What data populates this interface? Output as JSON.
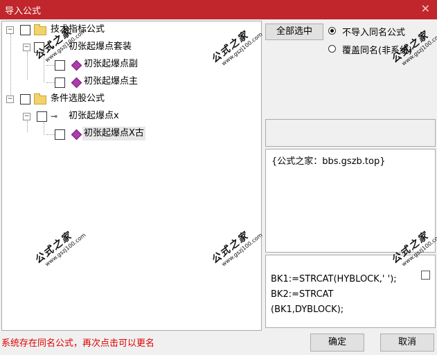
{
  "window": {
    "title": "导入公式"
  },
  "tree": {
    "items": [
      {
        "label": "技术指标公式"
      },
      {
        "label": "初张起爆点套装"
      },
      {
        "label": "初张起爆点副"
      },
      {
        "label": "初张起爆点主"
      },
      {
        "label": "条件选股公式"
      },
      {
        "label": "初张起爆点x"
      },
      {
        "label": "初张起爆点X古"
      }
    ]
  },
  "options": {
    "select_all_label": "全部选中",
    "radio_no_import": "不导入同名公式",
    "radio_overwrite": "覆盖同名(非系统)"
  },
  "info": {
    "text": "{公式之家：bbs.gszb.top}"
  },
  "code": {
    "lines": [
      "BK1:=STRCAT(HYBLOCK,' ');",
      "BK2:=STRCAT",
      "(BK1,DYBLOCK);"
    ]
  },
  "status": {
    "message": "系统存在同名公式，再次点击可以更名"
  },
  "buttons": {
    "ok": "确定",
    "cancel": "取消"
  },
  "watermark": {
    "line1": "公式之家",
    "line2": "www.gszj100.com"
  }
}
